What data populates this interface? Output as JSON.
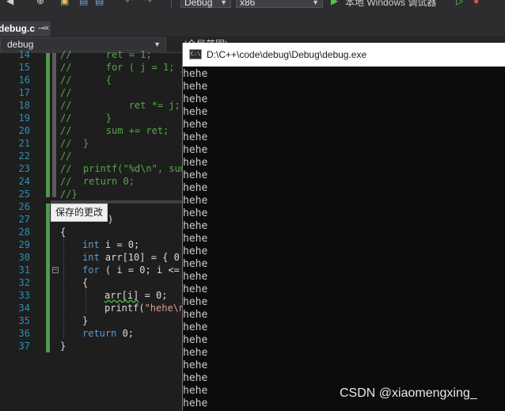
{
  "toolbar": {
    "config": "Debug",
    "platform": "x86",
    "run_label": "本地 Windows 调试器"
  },
  "tab": {
    "label": "debug.c",
    "pin": "⊸",
    "close": "×"
  },
  "nav": {
    "project": "debug",
    "scope": "(全局范围)"
  },
  "tooltip": "保存的更改",
  "console": {
    "title": "D:\\C++\\code\\debug\\Debug\\debug.exe",
    "icon_text": "C:\\",
    "output": [
      "hehe",
      "hehe",
      "hehe",
      "hehe",
      "hehe",
      "hehe",
      "hehe",
      "hehe",
      "hehe",
      "hehe",
      "hehe",
      "hehe",
      "hehe",
      "hehe",
      "hehe",
      "hehe",
      "hehe",
      "hehe",
      "hehe",
      "hehe",
      "hehe",
      "hehe",
      "hehe",
      "hehe",
      "hehe",
      "hehe",
      "hehe"
    ]
  },
  "editor": {
    "line_numbers": [
      "14",
      "15",
      "16",
      "17",
      "18",
      "19",
      "20",
      "21",
      "22",
      "23",
      "24",
      "25",
      "26",
      "27",
      "28",
      "29",
      "30",
      "31",
      "32",
      "33",
      "34",
      "35",
      "36",
      "37"
    ],
    "lines": {
      "l14": "//      ret = 1;",
      "l15": "//      for ( j = 1; j",
      "l16": "//      {",
      "l17": "//",
      "l18": "//          ret *= j;",
      "l19": "//      }",
      "l20": "//      sum += ret;",
      "l21": "//  }",
      "l22": "//",
      "l23": "//  printf(\"%d\\n\", sum",
      "l24": "//  return 0;",
      "l25": "//}",
      "l27_tail": ")",
      "l28": "{",
      "l29_kw": "int",
      "l29_rest": " i = 0;",
      "l30_kw": "int",
      "l30_rest": " arr[10] = { 0",
      "l31_kw": "for",
      "l31_rest": " ( i = 0; i <=",
      "l32": "{",
      "l33_sq": "arr[i]",
      "l33_rest": " = 0;",
      "l34_fn": "printf(",
      "l34_str": "\"hehe\\n",
      "l35": "}",
      "l36_kw": "return",
      "l36_rest": " 0;",
      "l37": "}"
    }
  },
  "watermark": "CSDN @xiaomengxing_",
  "colors": {
    "background": "#1e1e1e",
    "comment": "#57a64a",
    "keyword": "#569cd6",
    "string": "#d69d85",
    "line_number": "#2b91af",
    "console_bg": "#0c0c0c"
  }
}
